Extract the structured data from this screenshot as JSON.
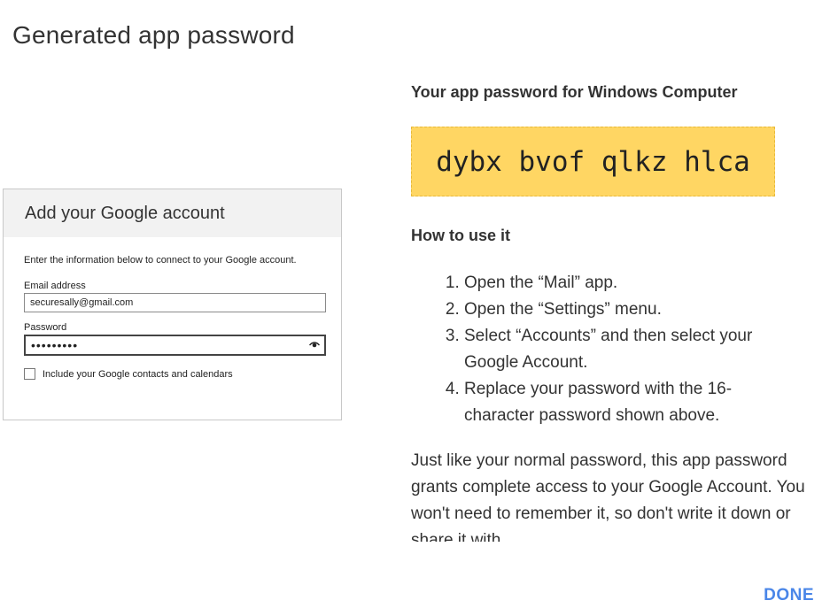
{
  "dialog": {
    "title": "Generated app password",
    "done_label": "DONE"
  },
  "illustration": {
    "header": "Add your Google account",
    "intro": "Enter the information below to connect to your Google account.",
    "email_label": "Email address",
    "email_value": "securesally@gmail.com",
    "password_label": "Password",
    "password_value": "•••••••••",
    "checkbox_label": "Include your Google contacts and calendars"
  },
  "app_password": {
    "heading": "Your app password for Windows Computer",
    "value": "dybx bvof qlkz hlca"
  },
  "how_to": {
    "heading": "How to use it",
    "steps": [
      "Open the “Mail” app.",
      "Open the “Settings” menu.",
      "Select “Accounts” and then select your Google Account.",
      "Replace your password with the 16-character password shown above."
    ],
    "note": "Just like your normal password, this app password grants complete access to your Google Account. You won't need to remember it, so don't write it down or share it with"
  },
  "colors": {
    "password_box": "#ffd663",
    "done_button": "#4a86e8"
  }
}
